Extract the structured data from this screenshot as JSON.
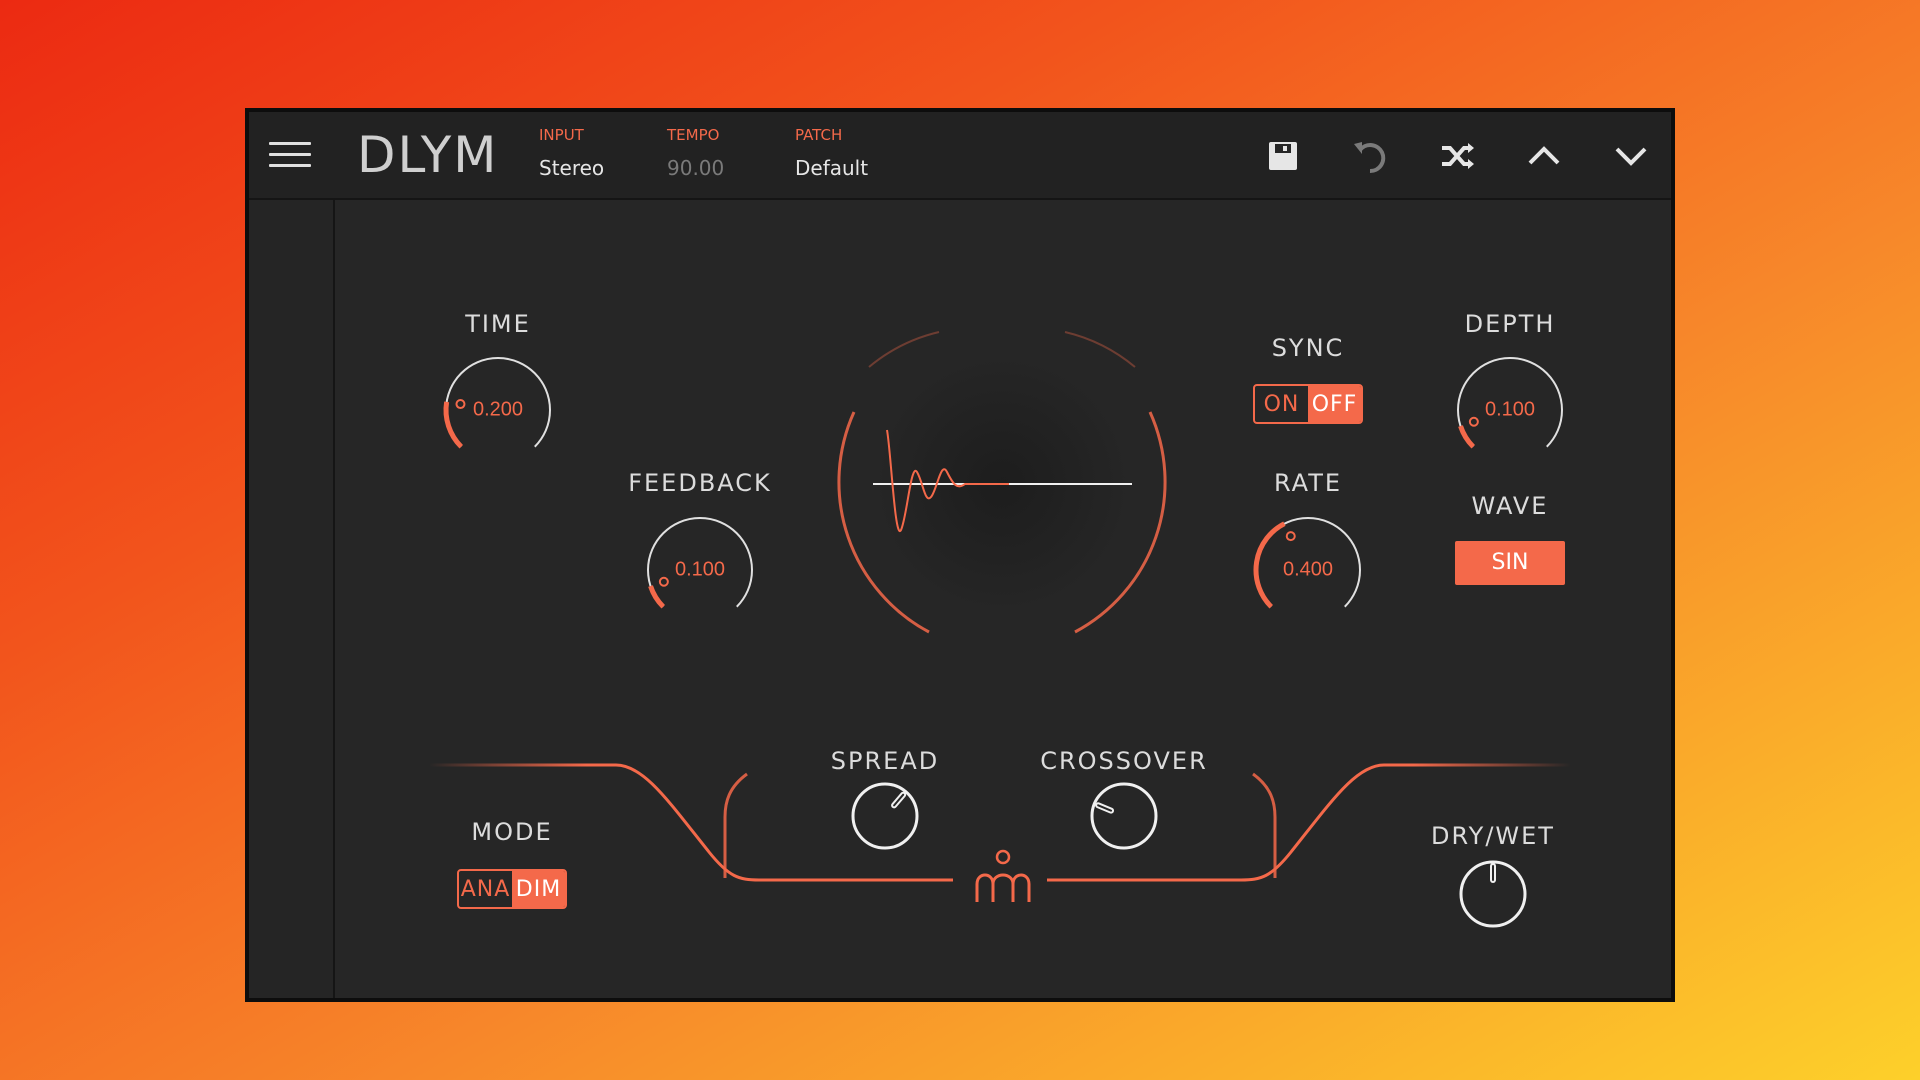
{
  "app": {
    "title": "DLYM"
  },
  "header": {
    "input": {
      "label": "INPUT",
      "value": "Stereo"
    },
    "tempo": {
      "label": "TEMPO",
      "value": "90.00"
    },
    "patch": {
      "label": "PATCH",
      "value": "Default"
    },
    "buttons": [
      "save-icon",
      "undo-icon",
      "shuffle-icon",
      "chevron-up-icon",
      "chevron-down-icon"
    ]
  },
  "controls": {
    "time": {
      "label": "TIME",
      "value": "0.200",
      "level": 0.2
    },
    "feedback": {
      "label": "FEEDBACK",
      "value": "0.100",
      "level": 0.1
    },
    "sync": {
      "label": "SYNC",
      "options": [
        "ON",
        "OFF"
      ],
      "selected": "OFF"
    },
    "depth": {
      "label": "DEPTH",
      "value": "0.100",
      "level": 0.1
    },
    "rate": {
      "label": "RATE",
      "value": "0.400",
      "level": 0.4
    },
    "wave": {
      "label": "WAVE",
      "value": "SIN"
    },
    "mode": {
      "label": "MODE",
      "options": [
        "ANA",
        "DIM"
      ],
      "selected": "DIM"
    },
    "spread": {
      "label": "SPREAD",
      "level": 0.65
    },
    "crossover": {
      "label": "CROSSOVER",
      "level": 0.25
    },
    "drywet": {
      "label": "DRY/WET",
      "level": 0.5
    }
  },
  "colors": {
    "accent": "#f4694a",
    "panel": "#262626",
    "text": "#dcdcdc"
  }
}
